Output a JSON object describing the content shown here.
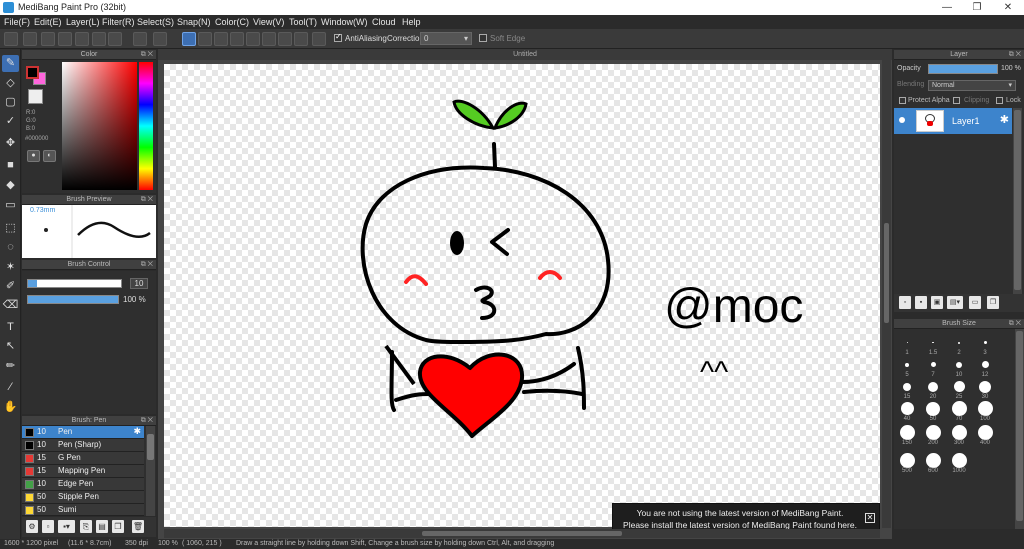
{
  "window": {
    "title": "MediBang Paint Pro (32bit)"
  },
  "menu": [
    "File(F)",
    "Edit(E)",
    "Layer(L)",
    "Filter(R)",
    "Select(S)",
    "Snap(N)",
    "Color(C)",
    "View(V)",
    "Tool(T)",
    "Window(W)",
    "Cloud",
    "Help"
  ],
  "toolbar": {
    "antialiasing_label": "AntiAliasing",
    "correction_label": "Correction",
    "correction_value": "0",
    "soft_edge_label": "Soft Edge"
  },
  "color_panel": {
    "title": "Color",
    "r": "R:0",
    "g": "G:0",
    "b": "B:0",
    "hex": "#000000",
    "foreground": "#000000",
    "background": "#ff66dd"
  },
  "brush_preview": {
    "title": "Brush Preview",
    "size": "0.73mm"
  },
  "brush_control": {
    "title": "Brush Control",
    "size_value": "10",
    "opacity_value": "100 %",
    "size_fraction": 0.1,
    "opacity_fraction": 1.0
  },
  "brush_list": {
    "title": "Brush: Pen",
    "items": [
      {
        "size": "10",
        "name": "Pen",
        "color": "#000000",
        "selected": true
      },
      {
        "size": "10",
        "name": "Pen (Sharp)",
        "color": "#000000"
      },
      {
        "size": "15",
        "name": "G Pen",
        "color": "#e53935"
      },
      {
        "size": "15",
        "name": "Mapping Pen",
        "color": "#e53935"
      },
      {
        "size": "10",
        "name": "Edge Pen",
        "color": "#43a047"
      },
      {
        "size": "50",
        "name": "Stipple Pen",
        "color": "#fdd835"
      },
      {
        "size": "50",
        "name": "Sumi",
        "color": "#fdd835"
      }
    ]
  },
  "canvas": {
    "tab_title": "Untitled",
    "drawing_text": "@moc",
    "drawing_face": "^^",
    "notice_line1": "You are not using the latest version of MediBang Paint.",
    "notice_line2": "Please install the latest version of MediBang Paint found here."
  },
  "layer_panel": {
    "title": "Layer",
    "opacity_label": "Opacity",
    "opacity_value": "100 %",
    "opacity_fraction": 1.0,
    "blending_label": "Blending",
    "blending_value": "Normal",
    "protect_alpha": "Protect Alpha",
    "clipping": "Clipping",
    "lock": "Lock",
    "layers": [
      {
        "name": "Layer1"
      }
    ]
  },
  "brush_size_panel": {
    "title": "Brush Size",
    "sizes": [
      "1",
      "1.5",
      "2",
      "3",
      "5",
      "7",
      "10",
      "12",
      "15",
      "20",
      "25",
      "30",
      "40",
      "50",
      "70",
      "100",
      "150",
      "200",
      "300",
      "400",
      "500",
      "600",
      "1000"
    ]
  },
  "status": {
    "size": "1600 * 1200 pixel",
    "physical": "(11.6 * 8.7cm)",
    "dpi": "350 dpi",
    "zoom": "100 %",
    "coords": "( 1060, 215 )",
    "hint": "Draw a straight line by holding down Shift, Change a brush size by holding down Ctrl, Alt, and dragging"
  }
}
